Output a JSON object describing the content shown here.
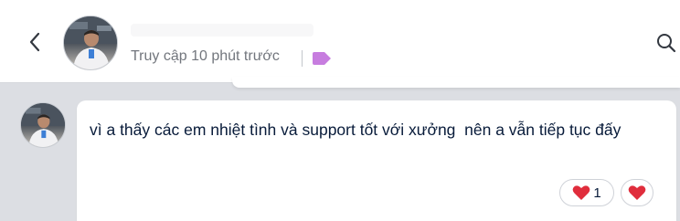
{
  "header": {
    "status_text": "Truy cập 10 phút trước"
  },
  "message": {
    "text": "vì a thấy các em nhiệt tình và support tốt với xưởng  nên a vẫn tiếp tục đấy"
  },
  "reactions": [
    {
      "icon": "heart-icon",
      "count": "1"
    },
    {
      "icon": "heart-icon"
    }
  ],
  "colors": {
    "header_bg": "#ffffff",
    "chat_bg": "#dcdee3",
    "tag_purple": "#c77ddf",
    "heart_red": "#e02d3c",
    "text_dark": "#081b3a",
    "text_muted": "#72767d"
  }
}
